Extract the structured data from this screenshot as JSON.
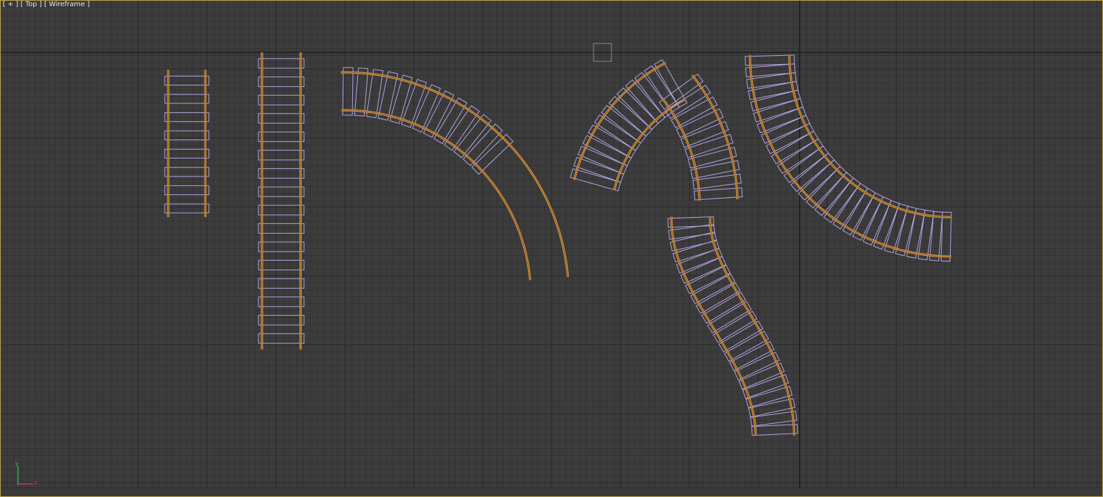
{
  "viewport": {
    "name": "Top",
    "label_parts": [
      "[ + ]",
      "[ Top ]",
      "[ Wireframe ]"
    ],
    "shading_mode": "Wireframe"
  },
  "colors": {
    "background": "#3c3c3c",
    "grid_minor": "#333333",
    "grid_major": "#1a1a1a",
    "rail": "#e8a044",
    "sleeper": "#b8a6e8",
    "active_border": "#c9a84a",
    "axis_x": "#d23a3a",
    "axis_y": "#3ab83a",
    "axis_z": "#3a6ad2"
  },
  "scene": {
    "objects": [
      {
        "name": "track-straight-short",
        "type": "straight"
      },
      {
        "name": "track-straight-long",
        "type": "straight"
      },
      {
        "name": "track-curve-large",
        "type": "curve"
      },
      {
        "name": "track-curve-small-left",
        "type": "curve"
      },
      {
        "name": "track-curve-small-right",
        "type": "curve"
      },
      {
        "name": "track-curve-quarter",
        "type": "curve"
      },
      {
        "name": "track-s-curve",
        "type": "s-curve"
      }
    ]
  },
  "axis_tripod": {
    "x_label": "x",
    "y_label": "y"
  }
}
